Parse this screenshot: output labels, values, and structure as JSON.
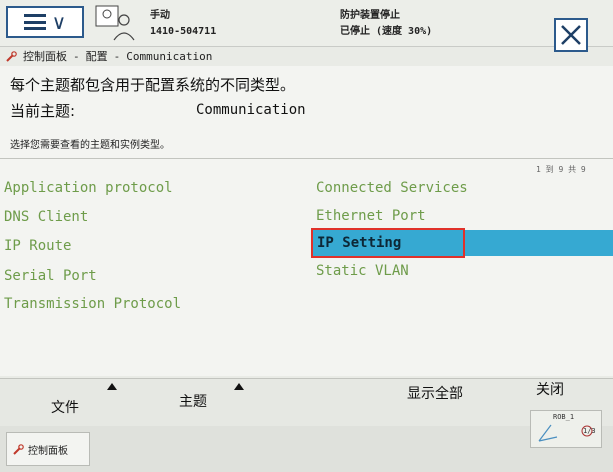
{
  "header": {
    "mode": "手动",
    "controller_id": "1410-504711",
    "status_line1": "防护装置停止",
    "status_line2": "已停止 (速度 30%)"
  },
  "breadcrumb": {
    "root": "控制面板",
    "sep1": "-",
    "mid": "配置",
    "sep2": "-",
    "current": "Communication"
  },
  "panel": {
    "description": "每个主题都包含用于配置系统的不同类型。",
    "current_topic_label": "当前主题:",
    "current_topic_value": "Communication",
    "instruction": "选择您需要查看的主题和实例类型。",
    "pager": "1 到 9 共 9"
  },
  "left_list": [
    "Application protocol",
    "DNS Client",
    "IP Route",
    "Serial Port",
    "Transmission Protocol"
  ],
  "right_list": [
    "Connected Services",
    "Ethernet Port",
    "IP Setting",
    "Static VLAN"
  ],
  "selected_item": "IP Setting",
  "toolbar": {
    "file": "文件",
    "topic": "主题",
    "show_all": "显示全部",
    "close": "关闭"
  },
  "statusbar": {
    "control_panel": "控制面板",
    "rob": "ROB_1",
    "rob_sub": "1/3"
  },
  "colors": {
    "list_text": "#6e9c4a",
    "selection": "#36a9d2",
    "highlight_border": "#e0312a",
    "accent": "#2c5a8c"
  }
}
